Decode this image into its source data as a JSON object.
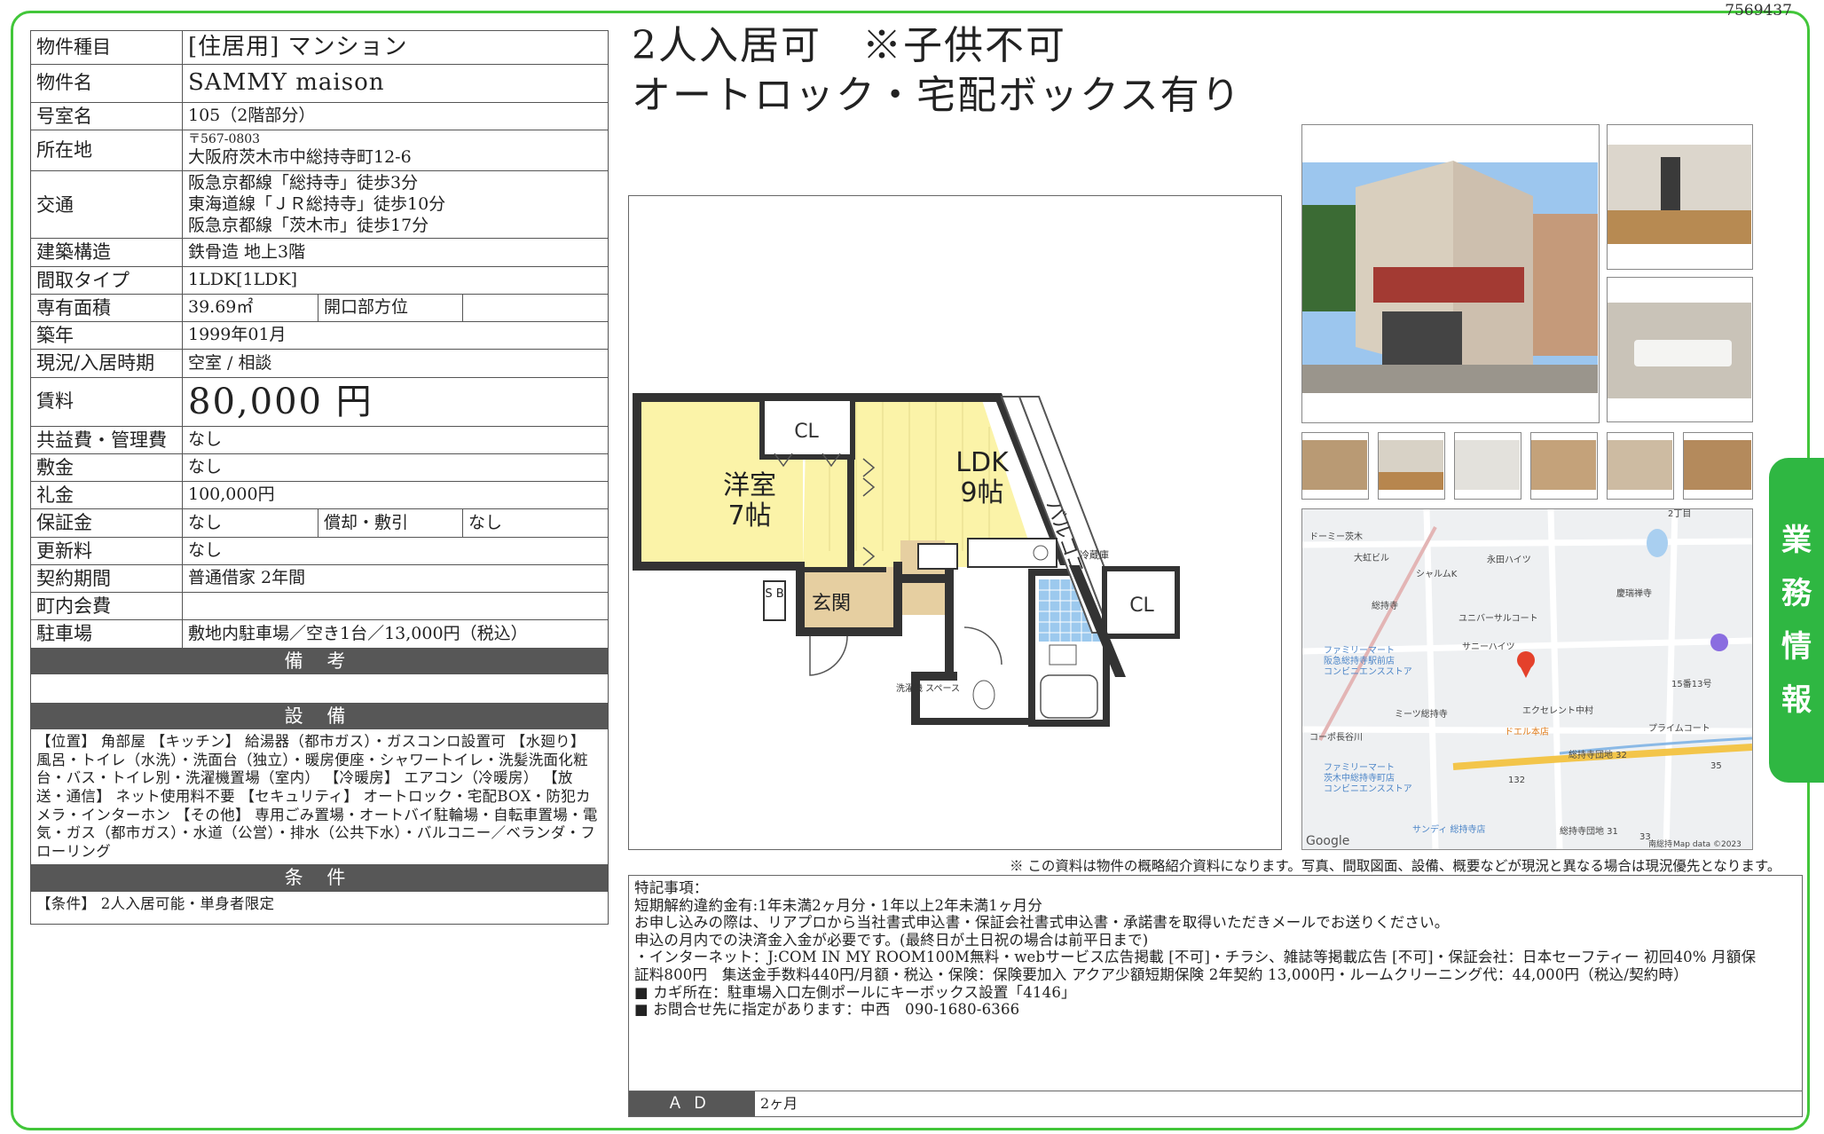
{
  "doc_id": "7569437",
  "headline": {
    "line1": "2人入居可　※子供不可",
    "line2": "オートロック・宅配ボックス有り"
  },
  "table": {
    "type_label": "物件種目",
    "type_value": "[住居用] マンション",
    "name_label": "物件名",
    "name_value": "SAMMY maison",
    "room_label": "号室名",
    "room_value": "105（2階部分）",
    "addr_label": "所在地",
    "addr_zip": "〒567-0803",
    "addr_value": "大阪府茨木市中総持寺町12-6",
    "access_label": "交通",
    "access_lines": [
      "阪急京都線「総持寺」徒歩3分",
      "東海道線「ＪＲ総持寺」徒歩10分",
      "阪急京都線「茨木市」徒歩17分"
    ],
    "struct_label": "建築構造",
    "struct_value": "鉄骨造 地上3階",
    "layout_label": "間取タイプ",
    "layout_value": "1LDK[1LDK]",
    "area_label": "専有面積",
    "area_value": "39.69㎡",
    "dir_label": "開口部方位",
    "dir_value": "",
    "built_label": "築年",
    "built_value": "1999年01月",
    "status_label": "現況/入居時期",
    "status_value": "空室 / 相談",
    "rent_label": "賃料",
    "rent_value": "80,000 円",
    "fee_label": "共益費・管理費",
    "fee_value": "なし",
    "deposit_label": "敷金",
    "deposit_value": "なし",
    "key_label": "礼金",
    "key_value": "100,000円",
    "guar_label": "保証金",
    "guar_value": "なし",
    "amort_label": "償却・敷引",
    "amort_value": "なし",
    "renew_label": "更新料",
    "renew_value": "なし",
    "contract_label": "契約期間",
    "contract_value": "普通借家 2年間",
    "town_label": "町内会費",
    "town_value": "",
    "parking_label": "駐車場",
    "parking_value": "敷地内駐車場／空き1台／13,000円（税込）",
    "remarks_header": "備 考",
    "remarks_value": "",
    "equip_header": "設 備",
    "equip_text": "【位置】 角部屋 【キッチン】 給湯器（都市ガス）・ガスコンロ設置可 【水廻り】 風呂・トイレ（水洗）・洗面台（独立）・暖房便座・シャワートイレ・洗髪洗面化粧台・バス・トイレ別・洗濯機置場（室内） 【冷暖房】 エアコン（冷暖房） 【放送・通信】 ネット使用料不要 【セキュリティ】 オートロック・宅配BOX・防犯カメラ・インターホン 【その他】 専用ごみ置場・オートバイ駐輪場・自転車置場・電気・ガス（都市ガス）・水道（公営）・排水（公共下水）・バルコニー／ベランダ・フローリング",
    "cond_header": "条 件",
    "cond_text": "【条件】 2人入居可能・単身者限定"
  },
  "floorplan": {
    "closet1": "CL",
    "closet2": "CL",
    "western_room": "洋室",
    "western_size": "7帖",
    "ldk": "LDK",
    "ldk_size": "9帖",
    "balcony": "バルコニー",
    "entrance": "玄関",
    "shoe_box": "S B",
    "fridge": "冷蔵庫",
    "washer": "洗濯機 スペース"
  },
  "map": {
    "labels": [
      "ドーミー茨木",
      "大虹ビル",
      "永田ハイツ",
      "シャルムK",
      "総持寺",
      "ユニバーサルコート",
      "慶瑞禅寺",
      "ファミリーマート",
      "阪急総持寺駅前店",
      "コンビニエンスストア",
      "サニーハイツ",
      "15番13号",
      "ミーツ総持寺",
      "エクセレント中村",
      "コーポ長谷川",
      "ドエル本店",
      "プライムコート",
      "ファミリーマート",
      "茨木中総持寺町店",
      "コンビニエンスストア",
      "総持寺団地 32",
      "35",
      "132",
      "サンディ 総持寺店",
      "総持寺団地 31",
      "33",
      "Google",
      "Map data ©2023",
      "2丁目",
      "南総持"
    ]
  },
  "side_tab": [
    "業",
    "務",
    "情",
    "報"
  ],
  "footnote": "※ この資料は物件の概略紹介資料になります。写真、間取図面、設備、概要などが現況と異なる場合は現況優先となります。",
  "special": {
    "lines": [
      "特記事項：",
      "短期解約違約金有:1年未満2ヶ月分・1年以上2年未満1ヶ月分",
      "お申し込みの際は、リアプロから当社書式申込書・保証会社書式申込書・承諾書を取得いただきメールでお送りください。",
      "申込の月内での決済金入金が必要です。(最終日が土日祝の場合は前平日まで)",
      "・インターネット：J:COM IN MY ROOM100M無料・webサービス広告掲載 [不可]・チラシ、雑誌等掲載広告 [不可]・保証会社：日本セーフティー 初回40% 月額保",
      "証料800円　集送金手数料440円/月額・税込・保険：保険要加入 アクア少額短期保険 2年契約 13,000円・ルームクリーニング代：44,000円（税込/契約時）",
      "■ カギ所在：駐車場入口左側ポールにキーボックス設置「4146」",
      "■ お問合せ先に指定があります：中西　090-1680-6366"
    ],
    "ad_label": "ＡＤ",
    "ad_value": "2ヶ月"
  },
  "colors": {
    "frame": "#42c63a",
    "tab": "#2fb742",
    "header_bg": "#575757",
    "room_yellow": "#fbf3a8",
    "entry_tan": "#e6cfa1",
    "bath_blue": "#7fb7e8"
  }
}
